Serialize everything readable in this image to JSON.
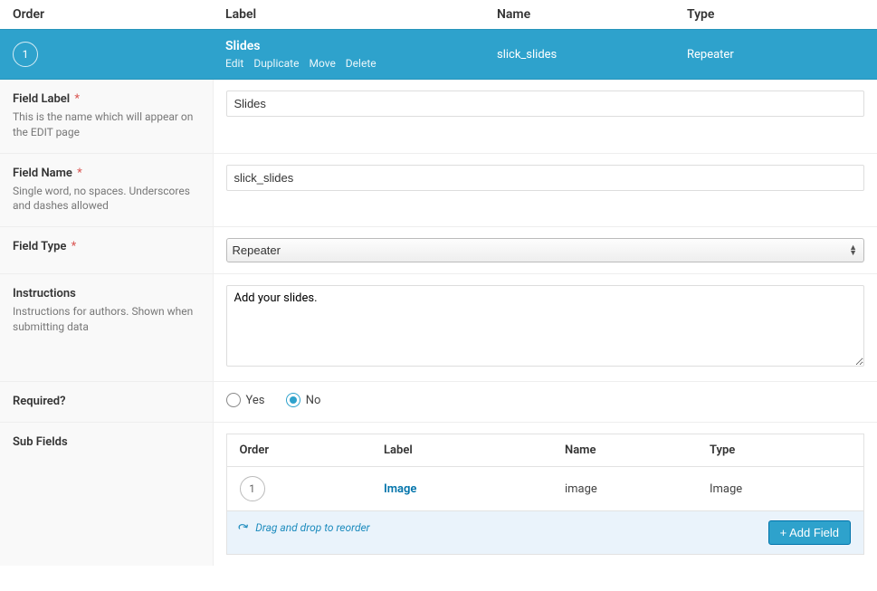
{
  "headers": {
    "order": "Order",
    "label": "Label",
    "name": "Name",
    "type": "Type"
  },
  "row": {
    "order": "1",
    "label": "Slides",
    "name": "slick_slides",
    "type": "Repeater",
    "actions": {
      "edit": "Edit",
      "duplicate": "Duplicate",
      "move": "Move",
      "delete": "Delete"
    }
  },
  "settings": {
    "field_label": {
      "title": "Field Label",
      "required": true,
      "desc": "This is the name which will appear on the EDIT page",
      "value": "Slides"
    },
    "field_name": {
      "title": "Field Name",
      "required": true,
      "desc": "Single word, no spaces. Underscores and dashes allowed",
      "value": "slick_slides"
    },
    "field_type": {
      "title": "Field Type",
      "required": true,
      "value": "Repeater"
    },
    "instructions": {
      "title": "Instructions",
      "desc": "Instructions for authors. Shown when submitting data",
      "value": "Add your slides."
    },
    "required": {
      "title": "Required?",
      "options": {
        "yes": "Yes",
        "no": "No"
      },
      "selected": "no"
    },
    "sub_fields": {
      "title": "Sub Fields",
      "headers": {
        "order": "Order",
        "label": "Label",
        "name": "Name",
        "type": "Type"
      },
      "rows": [
        {
          "order": "1",
          "label": "Image",
          "name": "image",
          "type": "Image"
        }
      ],
      "reorder_hint": "Drag and drop to reorder",
      "add_button": "+ Add Field"
    }
  }
}
